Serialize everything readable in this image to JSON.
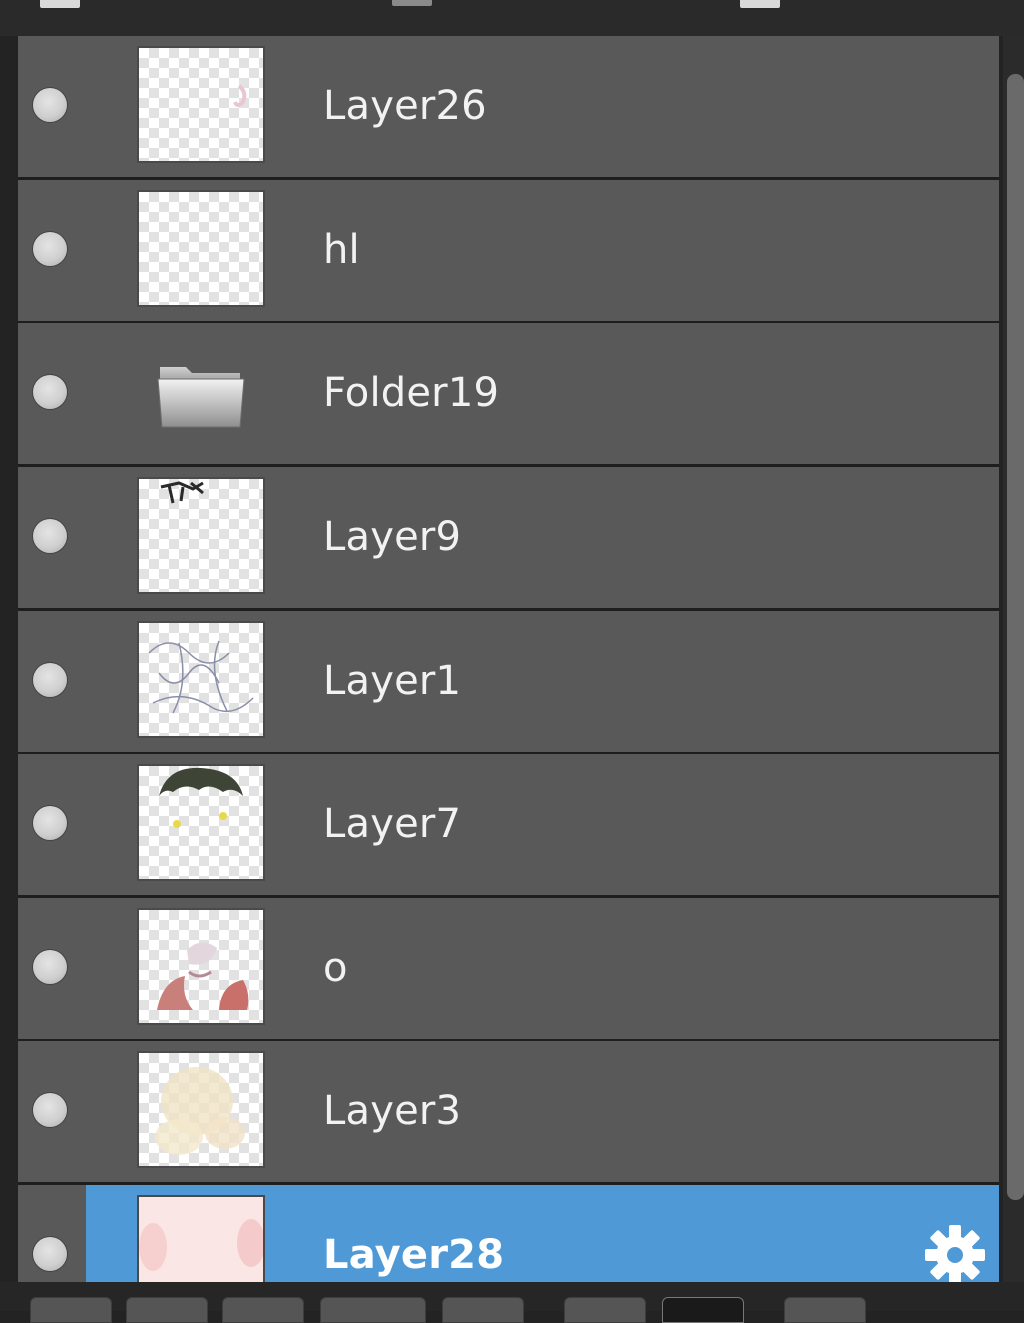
{
  "layers_panel": {
    "layers": [
      {
        "name": "Layer26",
        "kind": "raster",
        "thumb": "faint-pink-sketch",
        "selected": false
      },
      {
        "name": "hl",
        "kind": "raster",
        "thumb": "empty-transparent",
        "selected": false
      },
      {
        "name": "Folder19",
        "kind": "folder",
        "thumb": "folder-icon",
        "selected": false
      },
      {
        "name": "Layer9",
        "kind": "raster",
        "thumb": "dark-strokes-top",
        "selected": false
      },
      {
        "name": "Layer1",
        "kind": "raster",
        "thumb": "lineart-sketch",
        "selected": false
      },
      {
        "name": "Layer7",
        "kind": "raster",
        "thumb": "dark-hair-yellow-accents",
        "selected": false
      },
      {
        "name": "o",
        "kind": "raster",
        "thumb": "red-pink-shapes",
        "selected": false
      },
      {
        "name": "Layer3",
        "kind": "raster",
        "thumb": "pale-yellow-fill",
        "selected": false
      },
      {
        "name": "Layer28",
        "kind": "raster",
        "thumb": "light-pink-fill",
        "selected": true
      }
    ],
    "selected_color": "#4f9ad6",
    "row_color": "#595959",
    "settings_icon": "gear-icon"
  },
  "toolbar": {
    "buttons": [
      "tool-1",
      "tool-2",
      "tool-3",
      "tool-4",
      "tool-5",
      "tool-6",
      "tool-7",
      "tool-8"
    ],
    "active_index": 6
  }
}
